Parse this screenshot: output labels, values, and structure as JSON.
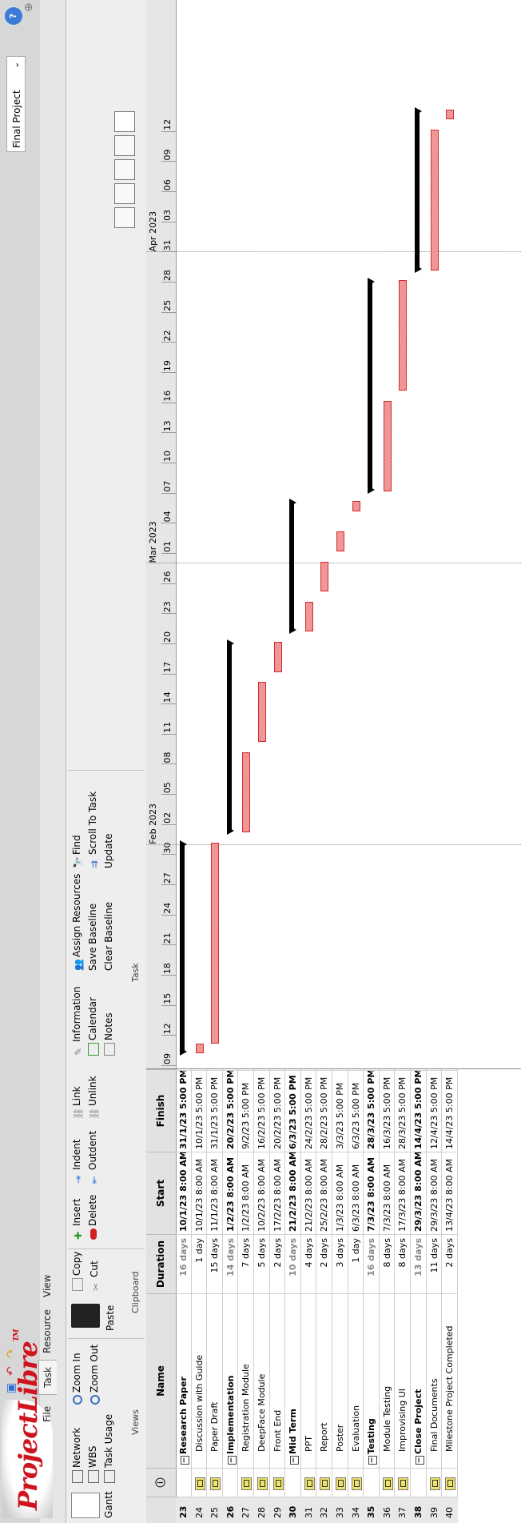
{
  "app": {
    "logo": "ProjectLibre",
    "logo_tm": "TM",
    "project_name": "Final Project"
  },
  "menu_tabs": [
    "File",
    "Task",
    "Resource",
    "View"
  ],
  "ribbon": {
    "views": {
      "gantt": "Gantt",
      "network": "Network",
      "wbs": "WBS",
      "task_usage": "Task Usage",
      "zoom_in": "Zoom In",
      "zoom_out": "Zoom Out",
      "group": "Views"
    },
    "clipboard": {
      "paste": "Paste",
      "copy": "Copy",
      "cut": "Cut",
      "group": "Clipboard"
    },
    "task": {
      "insert": "Insert",
      "delete": "Delete",
      "indent": "Indent",
      "outdent": "Outdent",
      "link": "Link",
      "unlink": "Unlink",
      "information": "Information",
      "calendar": "Calendar",
      "notes": "Notes",
      "assign_resources": "Assign Resources",
      "save_baseline": "Save Baseline",
      "clear_baseline": "Clear Baseline",
      "find": "Find",
      "scroll_to_task": "Scroll To Task",
      "update": "Update",
      "group": "Task"
    }
  },
  "table": {
    "headers": {
      "name": "Name",
      "duration": "Duration",
      "start": "Start",
      "finish": "Finish"
    },
    "rows": [
      {
        "id": "23",
        "name": "Research Paper",
        "duration": "16 days",
        "start": "10/1/23 8:00 AM",
        "finish": "31/1/23 5:00 PM",
        "summary": true,
        "note": false
      },
      {
        "id": "24",
        "name": "Discussion with Guide",
        "duration": "1 day",
        "start": "10/1/23 8:00 AM",
        "finish": "10/1/23 5:00 PM",
        "summary": false,
        "note": true
      },
      {
        "id": "25",
        "name": "Paper Draft",
        "duration": "15 days",
        "start": "11/1/23 8:00 AM",
        "finish": "31/1/23 5:00 PM",
        "summary": false,
        "note": true
      },
      {
        "id": "26",
        "name": "Implementation",
        "duration": "14 days",
        "start": "1/2/23 8:00 AM",
        "finish": "20/2/23 5:00 PM",
        "summary": true,
        "note": false
      },
      {
        "id": "27",
        "name": "Registration Module",
        "duration": "7 days",
        "start": "1/2/23 8:00 AM",
        "finish": "9/2/23 5:00 PM",
        "summary": false,
        "note": true
      },
      {
        "id": "28",
        "name": "DeepFace Module",
        "duration": "5 days",
        "start": "10/2/23 8:00 AM",
        "finish": "16/2/23 5:00 PM",
        "summary": false,
        "note": true
      },
      {
        "id": "29",
        "name": "Front End",
        "duration": "2 days",
        "start": "17/2/23 8:00 AM",
        "finish": "20/2/23 5:00 PM",
        "summary": false,
        "note": true
      },
      {
        "id": "30",
        "name": "Mid Term",
        "duration": "10 days",
        "start": "21/2/23 8:00 AM",
        "finish": "6/3/23 5:00 PM",
        "summary": true,
        "note": false
      },
      {
        "id": "31",
        "name": "PPT",
        "duration": "4 days",
        "start": "21/2/23 8:00 AM",
        "finish": "24/2/23 5:00 PM",
        "summary": false,
        "note": true
      },
      {
        "id": "32",
        "name": "Report",
        "duration": "2 days",
        "start": "25/2/23 8:00 AM",
        "finish": "28/2/23 5:00 PM",
        "summary": false,
        "note": true
      },
      {
        "id": "33",
        "name": "Poster",
        "duration": "3 days",
        "start": "1/3/23 8:00 AM",
        "finish": "3/3/23 5:00 PM",
        "summary": false,
        "note": true
      },
      {
        "id": "34",
        "name": "Evaluation",
        "duration": "1 day",
        "start": "6/3/23 8:00 AM",
        "finish": "6/3/23 5:00 PM",
        "summary": false,
        "note": true
      },
      {
        "id": "35",
        "name": "Testing",
        "duration": "16 days",
        "start": "7/3/23 8:00 AM",
        "finish": "28/3/23 5:00 PM",
        "summary": true,
        "note": false
      },
      {
        "id": "36",
        "name": "Module Testing",
        "duration": "8 days",
        "start": "7/3/23 8:00 AM",
        "finish": "16/3/23 5:00 PM",
        "summary": false,
        "note": true
      },
      {
        "id": "37",
        "name": "Improvising UI",
        "duration": "8 days",
        "start": "17/3/23 8:00 AM",
        "finish": "28/3/23 5:00 PM",
        "summary": false,
        "note": true
      },
      {
        "id": "38",
        "name": "Close Project",
        "duration": "13 days",
        "start": "29/3/23 8:00 AM",
        "finish": "14/4/23 5:00 PM",
        "summary": true,
        "note": false
      },
      {
        "id": "39",
        "name": "Final Documents",
        "duration": "11 days",
        "start": "29/3/23 8:00 AM",
        "finish": "12/4/23 5:00 PM",
        "summary": false,
        "note": true
      },
      {
        "id": "40",
        "name": "Milestone Project Completed",
        "duration": "2 days",
        "start": "13/4/23 8:00 AM",
        "finish": "14/4/23 5:00 PM",
        "summary": false,
        "note": true
      }
    ]
  },
  "gantt": {
    "months": [
      {
        "label": "Feb 2023",
        "day": 22
      },
      {
        "label": "Mar 2023",
        "day": 50
      },
      {
        "label": "Apr 2023",
        "day": 81
      }
    ],
    "day_labels": [
      "09",
      "12",
      "15",
      "18",
      "21",
      "24",
      "27",
      "30",
      "02",
      "05",
      "08",
      "11",
      "14",
      "17",
      "20",
      "23",
      "26",
      "01",
      "04",
      "07",
      "10",
      "13",
      "16",
      "19",
      "22",
      "25",
      "28",
      "31",
      "03",
      "06",
      "09",
      "12"
    ],
    "day_label_start": 0,
    "bars": [
      {
        "row": 0,
        "start": 1,
        "end": 22,
        "summary": true
      },
      {
        "row": 1,
        "start": 1,
        "end": 2,
        "summary": false
      },
      {
        "row": 2,
        "start": 2,
        "end": 22,
        "summary": false
      },
      {
        "row": 3,
        "start": 23,
        "end": 42,
        "summary": true
      },
      {
        "row": 4,
        "start": 23,
        "end": 31,
        "summary": false
      },
      {
        "row": 5,
        "start": 32,
        "end": 38,
        "summary": false
      },
      {
        "row": 6,
        "start": 39,
        "end": 42,
        "summary": false
      },
      {
        "row": 7,
        "start": 43,
        "end": 56,
        "summary": true
      },
      {
        "row": 8,
        "start": 43,
        "end": 46,
        "summary": false
      },
      {
        "row": 9,
        "start": 47,
        "end": 50,
        "summary": false
      },
      {
        "row": 10,
        "start": 51,
        "end": 53,
        "summary": false
      },
      {
        "row": 11,
        "start": 55,
        "end": 56,
        "summary": false
      },
      {
        "row": 12,
        "start": 57,
        "end": 78,
        "summary": true
      },
      {
        "row": 13,
        "start": 57,
        "end": 66,
        "summary": false
      },
      {
        "row": 14,
        "start": 67,
        "end": 78,
        "summary": false
      },
      {
        "row": 15,
        "start": 79,
        "end": 95,
        "summary": true
      },
      {
        "row": 16,
        "start": 79,
        "end": 93,
        "summary": false
      },
      {
        "row": 17,
        "start": 94,
        "end": 95,
        "summary": false
      }
    ]
  },
  "colors": {
    "bar_fill": "#ee8c8c",
    "bar_border": "#d42b2b",
    "summary": "#000000",
    "logo": "#d0141e"
  }
}
